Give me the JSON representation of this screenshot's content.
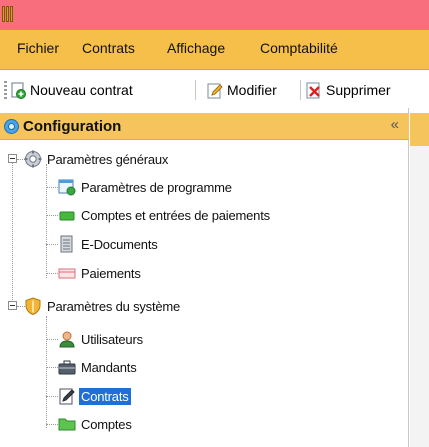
{
  "menu": {
    "items": [
      {
        "label": "Fichier"
      },
      {
        "label": "Contrats"
      },
      {
        "label": "Affichage"
      },
      {
        "label": "Comptabilité"
      }
    ]
  },
  "toolbar": {
    "new_label": "Nouveau contrat",
    "edit_label": "Modifier",
    "delete_label": "Supprimer"
  },
  "panel": {
    "title": "Configuration",
    "collapse_glyph": "«"
  },
  "tree": {
    "general": {
      "label": "Paramètres généraux",
      "children": [
        {
          "label": "Paramètres de programme",
          "icon": "program-settings-icon"
        },
        {
          "label": "Comptes et entrées de paiements",
          "icon": "green-folder-icon"
        },
        {
          "label": "E-Documents",
          "icon": "document-icon"
        },
        {
          "label": "Paiements",
          "icon": "payment-icon"
        }
      ]
    },
    "system": {
      "label": "Paramètres du système",
      "children": [
        {
          "label": "Utilisateurs",
          "icon": "user-icon"
        },
        {
          "label": "Mandants",
          "icon": "briefcase-icon"
        },
        {
          "label": "Contrats",
          "icon": "contract-edit-icon",
          "selected": true
        },
        {
          "label": "Comptes",
          "icon": "folder-icon"
        }
      ]
    }
  },
  "colors": {
    "titlebar": "#f96e7c",
    "menubar": "#f5bf4a",
    "panel_header": "#f5c45c",
    "selection": "#1f6fd6"
  }
}
